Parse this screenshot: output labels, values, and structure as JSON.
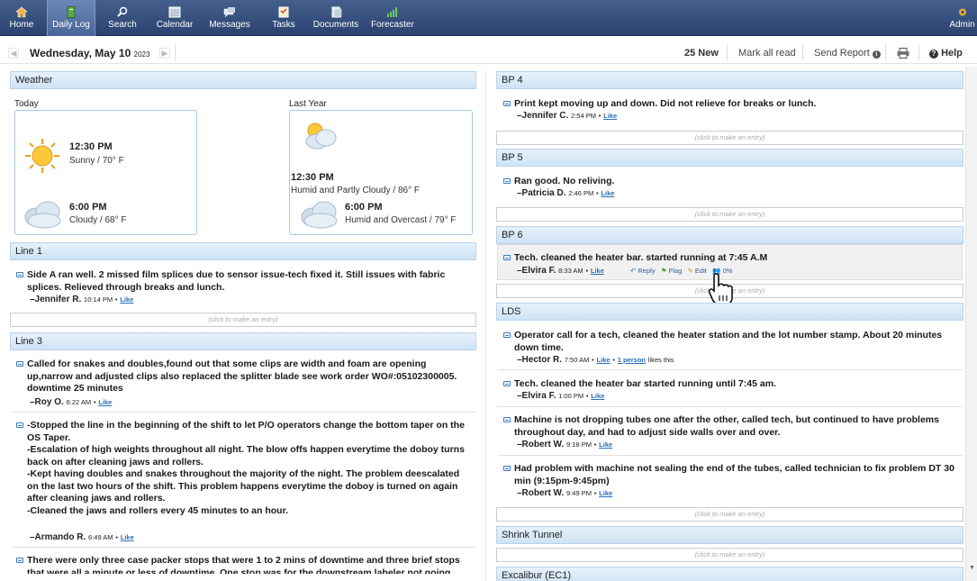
{
  "nav": {
    "home": "Home",
    "daily_log": "Daily Log",
    "search": "Search",
    "calendar": "Calendar",
    "messages": "Messages",
    "tasks": "Tasks",
    "documents": "Documents",
    "forecaster": "Forecaster",
    "admin": "Admin"
  },
  "datebar": {
    "date": "Wednesday, May 10",
    "year": "2023",
    "new_count": "25 New",
    "mark_all_read": "Mark all read",
    "send_report": "Send Report",
    "help": "Help"
  },
  "weather": {
    "title": "Weather",
    "today_label": "Today",
    "last_year_label": "Last Year",
    "today": [
      {
        "time": "12:30 PM",
        "desc": "Sunny / 70° F",
        "icon": "sun-icon"
      },
      {
        "time": "6:00 PM",
        "desc": "Cloudy / 68° F",
        "icon": "cloud-icon"
      }
    ],
    "last_year": [
      {
        "time": "12:30 PM",
        "desc": "Humid and Partly Cloudy / 86° F",
        "icon": "partly-cloudy-icon"
      },
      {
        "time": "6:00 PM",
        "desc": "Humid and Overcast / 79° F",
        "icon": "cloud-icon"
      }
    ]
  },
  "click_entry": "(click to make an entry)",
  "like": "Like",
  "line1": {
    "title": "Line 1",
    "e1": {
      "text": "Side A ran well. 2 missed film splices due to sensor issue-tech fixed it. Still issues with fabric splices. Relieved through breaks and lunch.",
      "author": "–Jennifer R.",
      "time": "10:14 PM"
    }
  },
  "line3": {
    "title": "Line 3",
    "e1": {
      "text": "Called for snakes and doubles,found out that some clips are width and foam are opening up,narrow and adjusted clips also replaced the splitter blade see work order WO#:05102300005. downtime 25 minutes",
      "author": "–Roy O.",
      "time": "6:22 AM"
    },
    "e2": {
      "l1": "-Stopped the line in the beginning of the shift to let P/O operators change the bottom taper on the OS Taper.",
      "l2": "-Escalation of high weights throughout all night. The blow offs happen everytime the doboy turns back on after cleaning jaws and rollers.",
      "l3": "-Kept having doubles and snakes throughout the majority of the night. The problem deescalated on the last two hours of the shift. This problem happens everytime the doboy is turned on again after cleaning jaws and rollers.",
      "l4": "-Cleaned the jaws and rollers every 45 minutes to an hour.",
      "author": "–Armando R.",
      "time": "6:49 AM"
    },
    "e3": {
      "text": "There were only three case packer stops that were 1 to 2 mins of downtime and three brief stops that were all a minute or less of downtime. One stop was for the downstream labeler not going"
    }
  },
  "bp4": {
    "title": "BP 4",
    "e1": {
      "text": "Print kept moving up and down. Did not relieve for breaks or lunch.",
      "author": "–Jennifer C.",
      "time": "2:54 PM"
    }
  },
  "bp5": {
    "title": "BP 5",
    "e1": {
      "text": "Ran good. No reliving.",
      "author": "–Patricia D.",
      "time": "2:46 PM"
    }
  },
  "bp6": {
    "title": "BP 6",
    "e1": {
      "text": "Tech. cleaned the heater bar. started running at 7:45 A.M",
      "author": "–Elvira F.",
      "time": "8:33 AM"
    },
    "actions": {
      "reply": "Reply",
      "flag": "Flag",
      "edit": "Edit",
      "pct": "0%"
    }
  },
  "lds": {
    "title": "LDS",
    "e1": {
      "text": "Operator call for a tech, cleaned the heater station and the lot number stamp. About 20 minutes down time.",
      "author": "–Hector R.",
      "time": "7:50 AM",
      "likes_link": "1 person",
      "likes_text": "likes this"
    },
    "e2": {
      "text": "Tech. cleaned the heater bar started running until 7:45 am.",
      "author": "–Elvira F.",
      "time": "1:00 PM"
    },
    "e3": {
      "text": "Machine is not dropping tubes one after the other, called tech, but continued to have problems throughout day, and had to adjust side walls over and over.",
      "author": "–Robert W.",
      "time": "9:18 PM"
    },
    "e4": {
      "text": "Had problem with machine not sealing the end of the tubes, called technician to fix problem DT 30 min (9:15pm-9:45pm)",
      "author": "–Robert W.",
      "time": "9:49 PM"
    }
  },
  "shrink": {
    "title": "Shrink Tunnel"
  },
  "excalibur": {
    "title": "Excalibur (EC1)"
  }
}
